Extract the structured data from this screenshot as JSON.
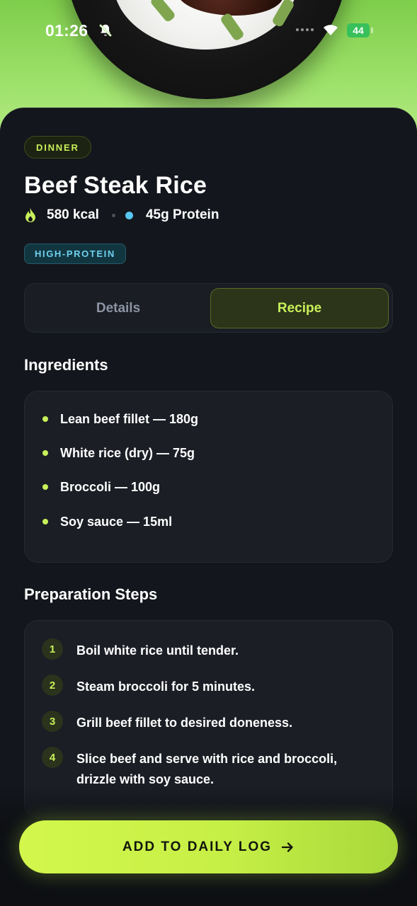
{
  "status_bar": {
    "time": "01:26",
    "battery": "44"
  },
  "meal": {
    "category": "DINNER",
    "title": "Beef Steak Rice",
    "calories": "580 kcal",
    "protein": "45g Protein",
    "tag": "HIGH-PROTEIN"
  },
  "tabs": {
    "details_label": "Details",
    "recipe_label": "Recipe",
    "active": "Recipe"
  },
  "ingredients": {
    "title": "Ingredients",
    "items": [
      "Lean beef fillet — 180g",
      "White rice (dry) — 75g",
      "Broccoli — 100g",
      "Soy sauce — 15ml"
    ]
  },
  "preparation": {
    "title": "Preparation Steps",
    "steps": [
      {
        "number": "1",
        "text": "Boil white rice until tender."
      },
      {
        "number": "2",
        "text": "Steam broccoli for 5 minutes."
      },
      {
        "number": "3",
        "text": "Grill beef fillet to desired doneness."
      },
      {
        "number": "4",
        "text": "Slice beef and serve with rice and broccoli, drizzle with soy sauce."
      }
    ]
  },
  "cta": {
    "label": "ADD TO DAILY LOG"
  },
  "icons": {
    "calories": "flame-icon",
    "notifications": "bell-off-icon",
    "cta": "arrow-right-icon"
  },
  "colors": {
    "accent": "#c8f05a",
    "protein": "#57c6f0",
    "card_background": "#13161c"
  }
}
